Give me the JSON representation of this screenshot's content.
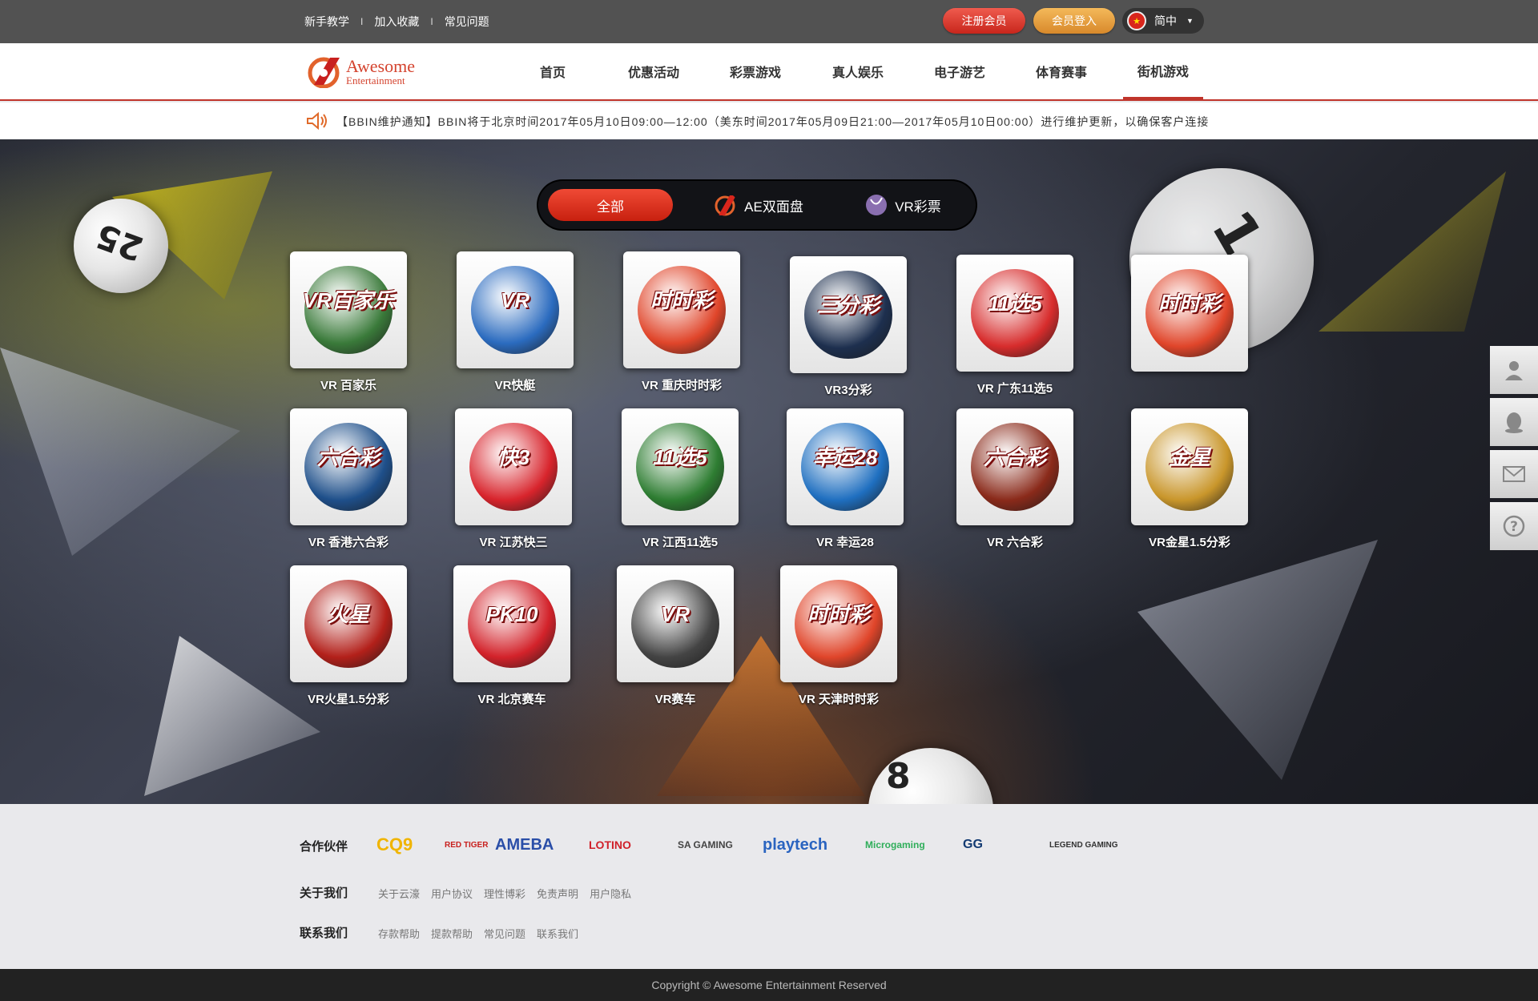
{
  "topbar": {
    "links": [
      "新手教学",
      "加入收藏",
      "常见问题"
    ],
    "separator": "I",
    "register_label": "注册会员",
    "login_label": "会员登入",
    "language": "简中"
  },
  "logo": {
    "line1": "Awesome",
    "line2": "Entertainment"
  },
  "nav": {
    "items": [
      "首页",
      "优惠活动",
      "彩票游戏",
      "真人娱乐",
      "电子游艺",
      "体育赛事",
      "街机游戏"
    ],
    "active_index": 6
  },
  "notice": {
    "text": "【BBIN维护通知】BBIN将于北京时间2017年05月10日09:00—12:00（美东时间2017年05月09日21:00—2017年05月10日00:00）进行维护更新，以确保客户连接"
  },
  "tabs": [
    {
      "label": "全部",
      "active": true
    },
    {
      "label": "AE双面盘",
      "active": false
    },
    {
      "label": "VR彩票",
      "active": false
    }
  ],
  "games": [
    {
      "name": "VR 百家乐",
      "art": "VR百家乐",
      "color": "#3a7a3a"
    },
    {
      "name": "VR快艇",
      "art": "VR",
      "color": "#2b6bbf"
    },
    {
      "name": "VR 重庆时时彩",
      "art": "时时彩",
      "color": "#e0452a"
    },
    {
      "name": "VR3分彩",
      "art": "三分彩",
      "color": "#1d2f4e"
    },
    {
      "name": "VR 广东11选5",
      "art": "11选5",
      "color": "#d72c2c"
    },
    {
      "name": "",
      "art": "时时彩",
      "color": "#e0452a"
    },
    {
      "name": "VR 香港六合彩",
      "art": "六合彩",
      "color": "#1e4f8a"
    },
    {
      "name": "VR 江苏快三",
      "art": "快3",
      "color": "#d8242c"
    },
    {
      "name": "VR 江西11选5",
      "art": "11选5",
      "color": "#2e7d32"
    },
    {
      "name": "VR 幸运28",
      "art": "幸运28",
      "color": "#1f6fc0"
    },
    {
      "name": "VR 六合彩",
      "art": "六合彩",
      "color": "#8a2a1a"
    },
    {
      "name": "VR金星1.5分彩",
      "art": "金星",
      "color": "#c9962b"
    },
    {
      "name": "VR火星1.5分彩",
      "art": "火星",
      "color": "#b3201a"
    },
    {
      "name": "VR 北京赛车",
      "art": "PK10",
      "color": "#d3222a"
    },
    {
      "name": "VR赛车",
      "art": "VR",
      "color": "#444"
    },
    {
      "name": "VR 天津时时彩",
      "art": "时时彩",
      "color": "#e0452a"
    }
  ],
  "balls": [
    {
      "label": "25"
    },
    {
      "label": "1"
    },
    {
      "label": "8"
    }
  ],
  "side_icons": [
    "user-icon",
    "qq-icon",
    "mail-icon",
    "help-icon"
  ],
  "footer": {
    "partners_label": "合作伙伴",
    "partners": [
      {
        "name": "CQ9",
        "color": "#f0b400"
      },
      {
        "name": "RED TIGER",
        "color": "#c8201e"
      },
      {
        "name": "AMEBA",
        "color": "#2a4ea8"
      },
      {
        "name": "LOTINO",
        "color": "#d0202a"
      },
      {
        "name": "SA GAMING",
        "color": "#444"
      },
      {
        "name": "playtech",
        "color": "#2a64c0"
      },
      {
        "name": "Microgaming",
        "color": "#2fae5a"
      },
      {
        "name": "GG",
        "color": "#123a72"
      },
      {
        "name": "LEGEND GAMING",
        "color": "#333"
      }
    ],
    "about_label": "关于我们",
    "about_links": [
      "关于云濠",
      "用户协议",
      "理性博彩",
      "免责声明",
      "用户隐私"
    ],
    "contact_label": "联系我们",
    "contact_links": [
      "存款帮助",
      "提款帮助",
      "常见问题",
      "联系我们"
    ],
    "copyright": "Copyright © Awesome Entertainment Reserved"
  }
}
